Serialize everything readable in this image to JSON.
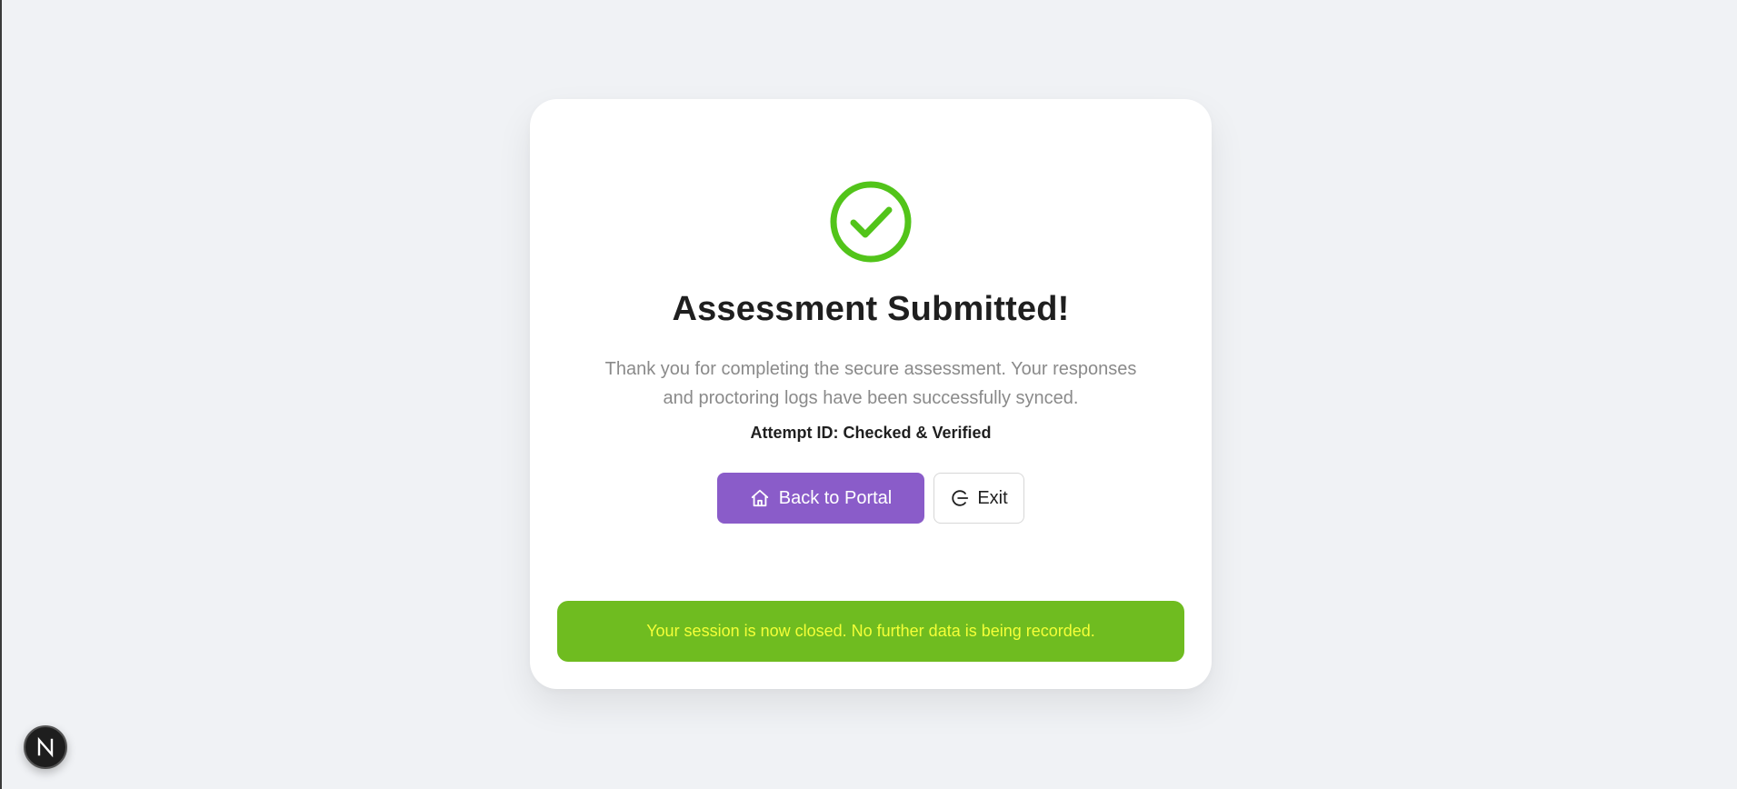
{
  "card": {
    "title": "Assessment Submitted!",
    "message": "Thank you for completing the secure assessment. Your responses and proctoring logs have been successfully synced.",
    "attempt_id": "Attempt ID: Checked & Verified",
    "icon": "check-circle-icon"
  },
  "actions": {
    "back_label": "Back to Portal",
    "back_icon": "home-icon",
    "exit_label": "Exit",
    "exit_icon": "logout-icon"
  },
  "status_banner": {
    "text": "Your session is now closed. No further data is being recorded."
  },
  "framework_badge": {
    "letter": "N"
  },
  "colors": {
    "background": "#f0f2f5",
    "success": "#52c41a",
    "primary": "#8a5cc9",
    "banner_bg": "#6fbc20",
    "banner_text": "#f4ff38"
  }
}
